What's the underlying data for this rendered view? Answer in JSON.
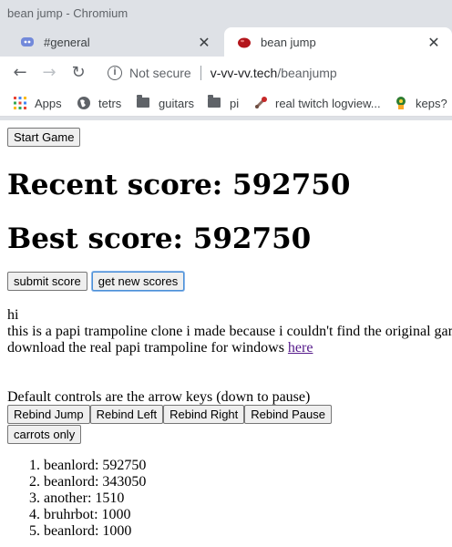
{
  "window": {
    "title": "bean jump - Chromium"
  },
  "tabs": [
    {
      "label": "#general",
      "active": false
    },
    {
      "label": "bean jump",
      "active": true
    }
  ],
  "toolbar": {
    "security": "Not secure",
    "url_host": "v-vv-vv.tech",
    "url_path": "/beanjump"
  },
  "bookmarks": [
    {
      "label": "Apps",
      "icon": "apps-grid-icon"
    },
    {
      "label": "tetrs",
      "icon": "globe-icon"
    },
    {
      "label": "guitars",
      "icon": "folder-icon"
    },
    {
      "label": "pi",
      "icon": "folder-icon"
    },
    {
      "label": "real twitch logview...",
      "icon": "bookmark-favicon-icon"
    },
    {
      "label": "keps?",
      "icon": "bookmark-favicon-icon"
    }
  ],
  "page": {
    "start_button": "Start Game",
    "recent_score": "Recent score: 592750",
    "best_score": "Best score: 592750",
    "submit_button": "submit score",
    "get_scores_button": "get new scores",
    "intro_line1": "hi",
    "intro_line2": "this is a papi trampoline clone i made because i couldn't find the original game",
    "intro_line3_prefix": "download the real papi trampoline for windows ",
    "intro_link": "here",
    "controls_text": "Default controls are the arrow keys (down to pause)",
    "rebind_jump": "Rebind Jump",
    "rebind_left": "Rebind Left",
    "rebind_right": "Rebind Right",
    "rebind_pause": "Rebind Pause",
    "carrots_button": "carrots only"
  },
  "leaderboard": [
    "beanlord: 592750",
    "beanlord: 343050",
    "another: 1510",
    "bruhrbot: 1000",
    "beanlord: 1000"
  ],
  "colors": {
    "chrome_bg": "#dee1e6",
    "link": "#551a8b",
    "focus": "#4a8fd6"
  }
}
